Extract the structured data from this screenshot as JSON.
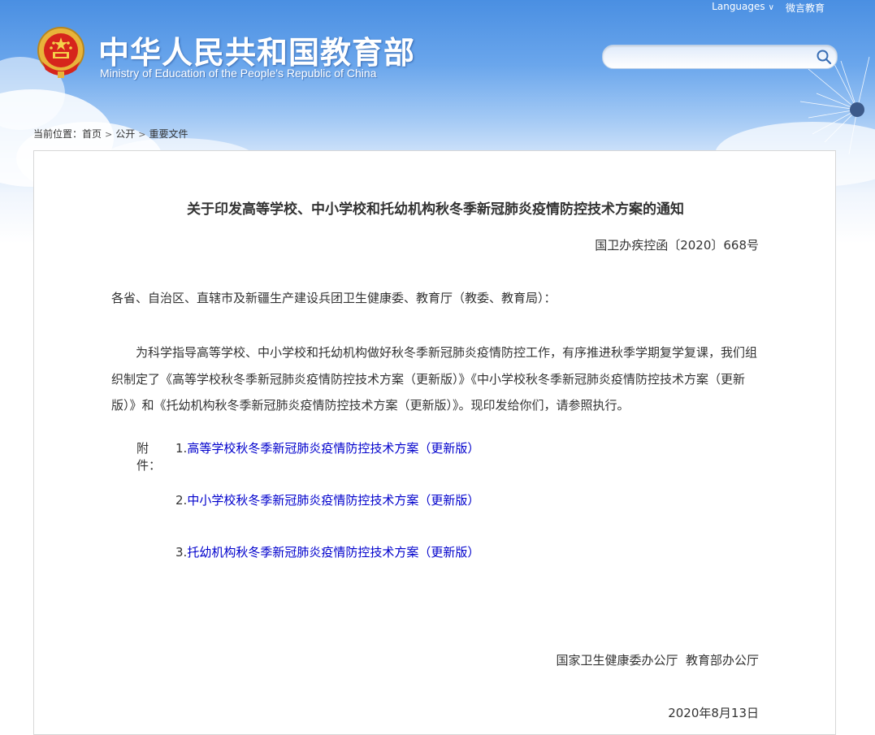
{
  "header": {
    "top_links": {
      "languages": "Languages",
      "weixin": "微言教育"
    },
    "title_cn": "中华人民共和国教育部",
    "title_en": "Ministry of Education of the People's Republic of China",
    "search": {
      "value": "",
      "placeholder": ""
    }
  },
  "breadcrumb": {
    "prefix": "当前位置：",
    "items": [
      "首页",
      "公开",
      "重要文件"
    ]
  },
  "document": {
    "title": "关于印发高等学校、中小学校和托幼机构秋冬季新冠肺炎疫情防控技术方案的通知",
    "number": "国卫办疾控函〔2020〕668号",
    "salutation": "各省、自治区、直辖市及新疆生产建设兵团卫生健康委、教育厅（教委、教育局）：",
    "body": "为科学指导高等学校、中小学校和托幼机构做好秋冬季新冠肺炎疫情防控工作，有序推进秋季学期复学复课，我们组织制定了《高等学校秋冬季新冠肺炎疫情防控技术方案（更新版）》《中小学校秋冬季新冠肺炎疫情防控技术方案（更新版）》和《托幼机构秋冬季新冠肺炎疫情防控技术方案（更新版）》。现印发给你们，请参照执行。",
    "attachments_label": "附件：",
    "attachments": [
      {
        "num": "1.",
        "title": "高等学校秋冬季新冠肺炎疫情防控技术方案（更新版）"
      },
      {
        "num": "2.",
        "title": "中小学校秋冬季新冠肺炎疫情防控技术方案（更新版）"
      },
      {
        "num": "3.",
        "title": "托幼机构秋冬季新冠肺炎疫情防控技术方案（更新版）"
      }
    ],
    "signature": "国家卫生健康委办公厅  教育部办公厅",
    "date": "2020年8月13日"
  },
  "colors": {
    "link": "#0000cc",
    "text": "#333333",
    "header_blue": "#4a8fe2"
  },
  "icons": {
    "search": "search-icon",
    "emblem": "national-emblem-icon",
    "dropdown": "chevron-down-icon"
  }
}
